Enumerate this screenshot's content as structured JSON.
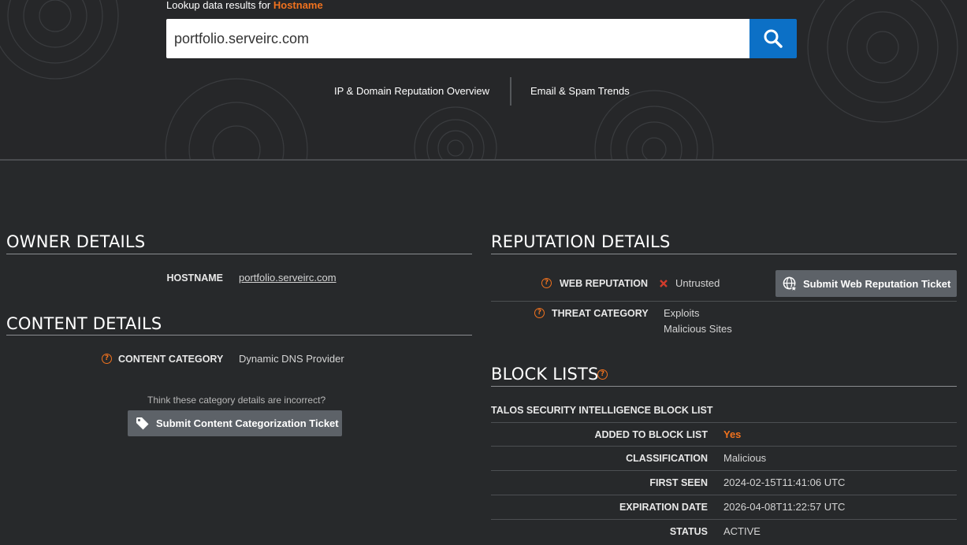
{
  "search": {
    "label_prefix": "Lookup data results for ",
    "label_highlight": "Hostname",
    "value": "portfolio.serveirc.com",
    "button_icon": "search-icon"
  },
  "nav": {
    "link1": "IP & Domain Reputation Overview",
    "link2": "Email & Spam Trends"
  },
  "owner": {
    "title": "OWNER DETAILS",
    "hostname_label": "HOSTNAME",
    "hostname_value": "portfolio.serveirc.com"
  },
  "content": {
    "title": "CONTENT DETAILS",
    "category_label": "CONTENT CATEGORY",
    "category_value": "Dynamic DNS Provider",
    "incorrect_prompt": "Think these category details are incorrect?",
    "ticket_button": "Submit Content Categorization Ticket",
    "ticket_icon": "tag-icon"
  },
  "reputation": {
    "title": "REPUTATION DETAILS",
    "web_label": "WEB REPUTATION",
    "web_value": "Untrusted",
    "web_status_icon": "x-icon",
    "ticket_button": "Submit Web Reputation Ticket",
    "ticket_icon": "globe-icon",
    "threat_label": "THREAT CATEGORY",
    "threat_values": [
      "Exploits",
      "Malicious Sites"
    ]
  },
  "blocklists": {
    "title": "BLOCK LISTS",
    "subtitle": "TALOS SECURITY INTELLIGENCE BLOCK LIST",
    "rows": [
      {
        "label": "ADDED TO BLOCK LIST",
        "value": "Yes"
      },
      {
        "label": "CLASSIFICATION",
        "value": "Malicious"
      },
      {
        "label": "FIRST SEEN",
        "value": "2024-02-15T11:41:06 UTC"
      },
      {
        "label": "EXPIRATION DATE",
        "value": "2026-04-08T11:22:57 UTC"
      },
      {
        "label": "STATUS",
        "value": "ACTIVE"
      }
    ]
  },
  "colors": {
    "accent": "#f0721e",
    "search_button": "#0c70c6",
    "background": "#27292b",
    "button_grey": "#5d6268"
  }
}
